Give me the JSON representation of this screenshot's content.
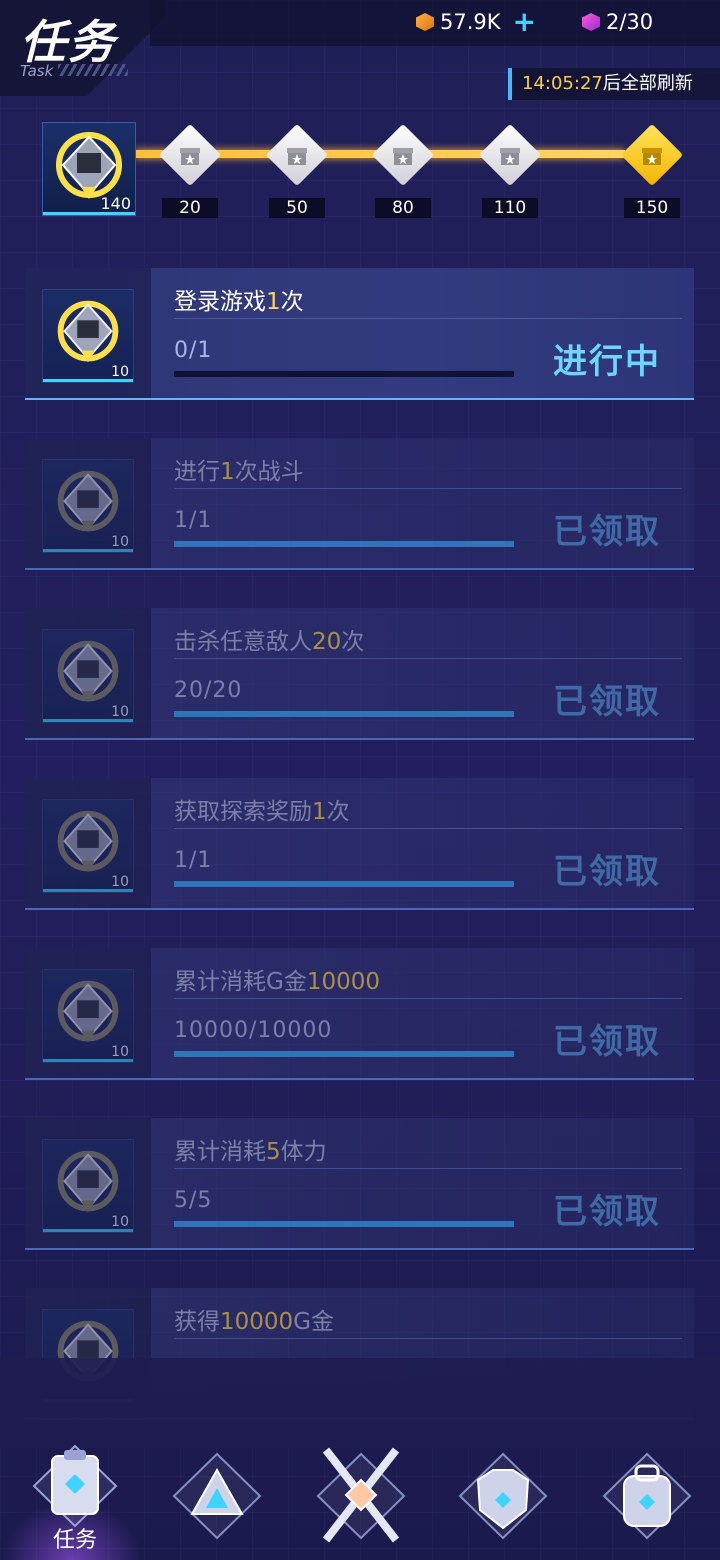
{
  "header": {
    "title": "任务",
    "subtitle": "Task",
    "coins": "57.9K",
    "coins_plus": "+",
    "energy": "2/30",
    "refresh_time": "14:05:27",
    "refresh_text": "后全部刷新"
  },
  "milestones": {
    "current": "140",
    "nodes": [
      {
        "value": "20",
        "state": "claimed"
      },
      {
        "value": "50",
        "state": "claimed"
      },
      {
        "value": "80",
        "state": "claimed"
      },
      {
        "value": "110",
        "state": "claimed"
      },
      {
        "value": "150",
        "state": "available"
      }
    ]
  },
  "tasks": [
    {
      "pre": "登录游戏",
      "num": "1",
      "post": "次",
      "progress": "0/1",
      "fill": 0,
      "reward": "10",
      "status": "进行中",
      "done": false
    },
    {
      "pre": "进行",
      "num": "1",
      "post": "次战斗",
      "progress": "1/1",
      "fill": 1,
      "reward": "10",
      "status": "已领取",
      "done": true
    },
    {
      "pre": "击杀任意敌人",
      "num": "20",
      "post": "次",
      "progress": "20/20",
      "fill": 1,
      "reward": "10",
      "status": "已领取",
      "done": true
    },
    {
      "pre": "获取探索奖励",
      "num": "1",
      "post": "次",
      "progress": "1/1",
      "fill": 1,
      "reward": "10",
      "status": "已领取",
      "done": true
    },
    {
      "pre": "累计消耗G金",
      "num": "10000",
      "post": "",
      "progress": "10000/10000",
      "fill": 1,
      "reward": "10",
      "status": "已领取",
      "done": true
    },
    {
      "pre": "累计消耗",
      "num": "5",
      "post": "体力",
      "progress": "5/5",
      "fill": 1,
      "reward": "10",
      "status": "已领取",
      "done": true
    },
    {
      "pre": "获得",
      "num": "10000",
      "post": "G金",
      "progress": "",
      "fill": 0,
      "reward": "",
      "status": "",
      "done": true
    }
  ],
  "nav": {
    "tasks_label": "任务",
    "icons": [
      "clipboard-icon",
      "triangle-icon",
      "crossed-swords-icon",
      "mech-armor-icon",
      "backpack-icon"
    ]
  },
  "colors": {
    "accent": "#3fd4ff",
    "gold": "#ffd65a",
    "bg": "#231f5e"
  }
}
